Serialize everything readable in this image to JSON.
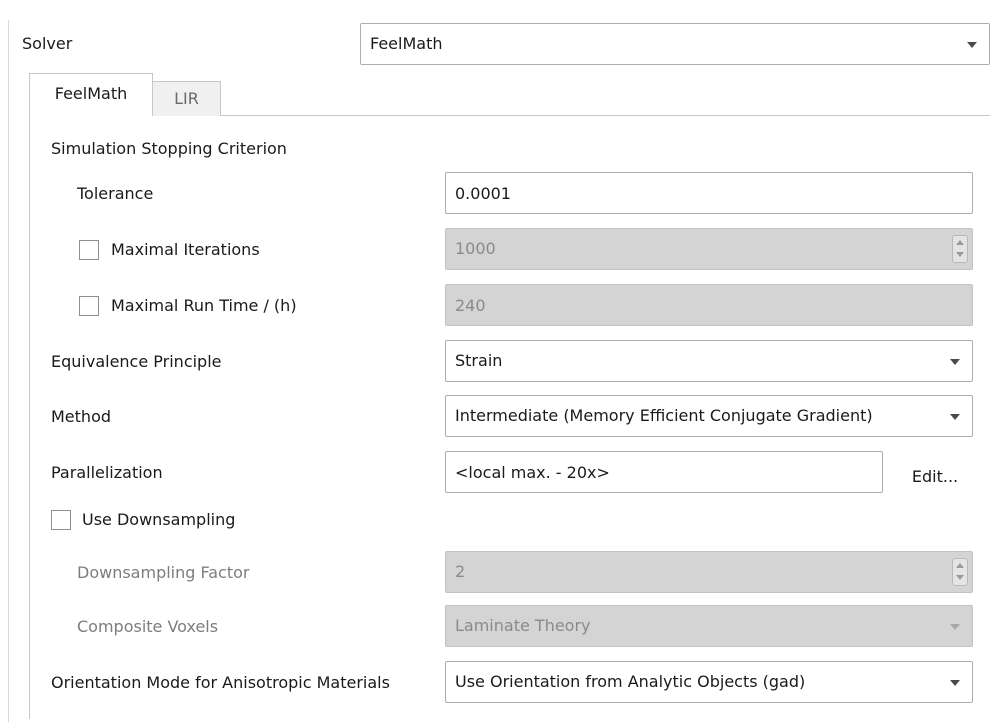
{
  "solver": {
    "label": "Solver",
    "selected": "FeelMath"
  },
  "tabs": [
    {
      "label": "FeelMath",
      "active": true
    },
    {
      "label": "LIR",
      "active": false
    }
  ],
  "stopping": {
    "section_label": "Simulation Stopping Criterion",
    "tolerance_label": "Tolerance",
    "tolerance_value": "0.0001",
    "max_iterations_label": "Maximal Iterations",
    "max_iterations_checked": false,
    "max_iterations_value": "1000",
    "max_runtime_label": "Maximal Run Time / (h)",
    "max_runtime_checked": false,
    "max_runtime_value": "240"
  },
  "equivalence": {
    "label": "Equivalence Principle",
    "selected": "Strain"
  },
  "method": {
    "label": "Method",
    "selected": "Intermediate (Memory Efficient Conjugate Gradient)"
  },
  "parallelization": {
    "label": "Parallelization",
    "value": "<local max. - 20x>",
    "edit_label": "Edit..."
  },
  "downsampling": {
    "use_label": "Use Downsampling",
    "use_checked": false,
    "factor_label": "Downsampling Factor",
    "factor_value": "2",
    "composite_label": "Composite Voxels",
    "composite_selected": "Laminate Theory"
  },
  "orientation": {
    "label": "Orientation Mode for Anisotropic Materials",
    "selected": "Use Orientation from Analytic Objects (gad)"
  },
  "icons": {
    "dropdown": "chevron-down-icon",
    "spin_up": "spin-up-icon",
    "spin_down": "spin-down-icon"
  },
  "colors": {
    "disabled_field_bg": "#d4d4d4",
    "disabled_text": "#7d7d7d",
    "border": "#adadad"
  }
}
